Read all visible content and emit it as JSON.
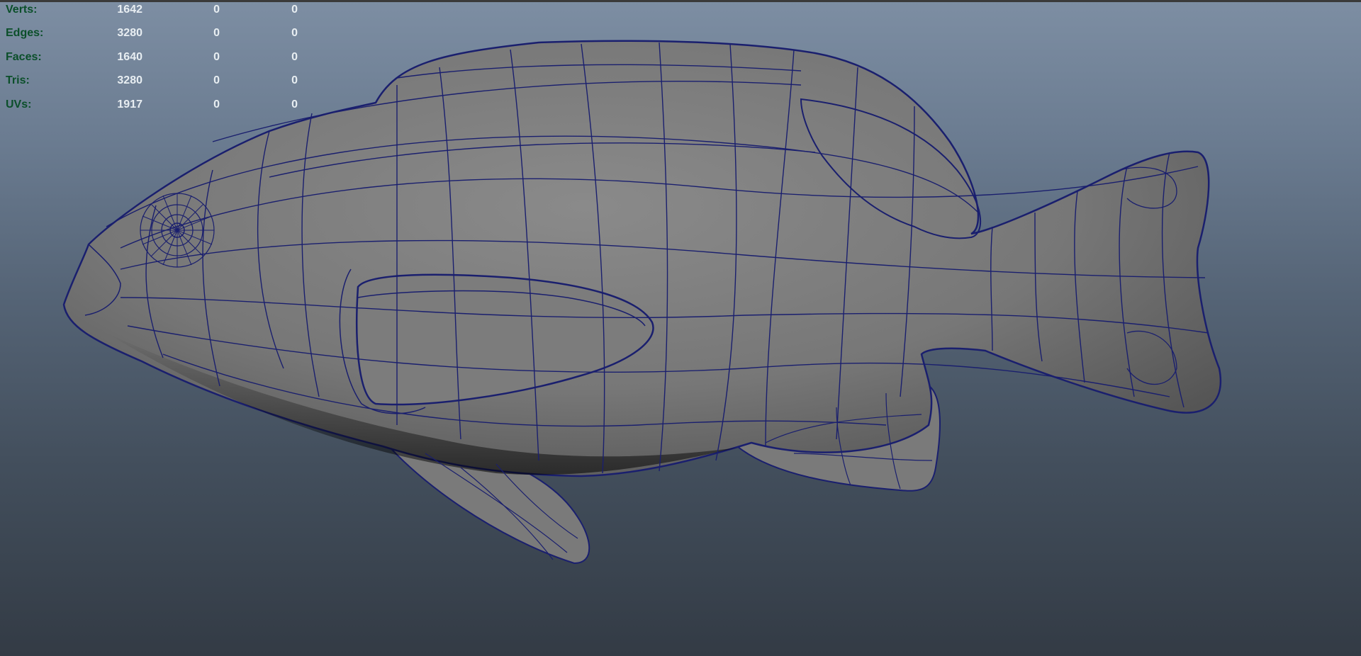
{
  "viewport": {
    "background_top": "#7d8ea3",
    "background_bottom": "#333b45",
    "wire_color": "#1a1f6e",
    "mesh_fill": "#7c7c7c"
  },
  "heads_up_display": {
    "rows": [
      {
        "label": "Verts:",
        "values": [
          "1642",
          "0",
          "0"
        ]
      },
      {
        "label": "Edges:",
        "values": [
          "3280",
          "0",
          "0"
        ]
      },
      {
        "label": "Faces:",
        "values": [
          "1640",
          "0",
          "0"
        ]
      },
      {
        "label": "Tris:",
        "values": [
          "3280",
          "0",
          "0"
        ]
      },
      {
        "label": "UVs:",
        "values": [
          "1917",
          "0",
          "0"
        ]
      }
    ]
  },
  "model": {
    "object": "fish-mesh",
    "display_mode": "wireframe-on-shaded"
  }
}
